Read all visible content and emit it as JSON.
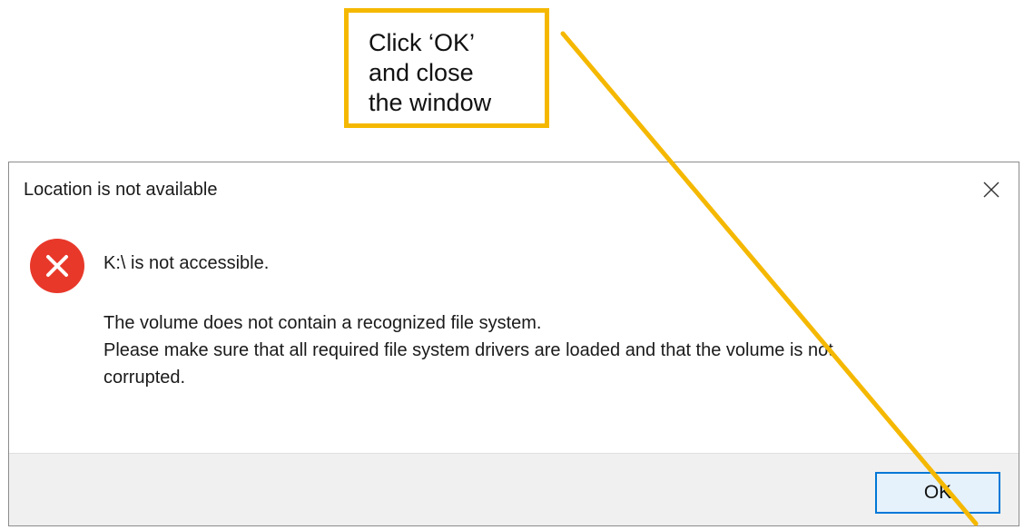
{
  "annotation": {
    "lines": [
      "Click ‘OK’",
      "and close",
      "the window"
    ],
    "color": "#f5b800"
  },
  "dialog": {
    "title": "Location is not available",
    "close_icon": "close-icon",
    "error_icon": "error-circle-x-icon",
    "error_color": "#e8382a",
    "message_main": "K:\\ is not accessible.",
    "message_detail": [
      "The volume does not contain a recognized file system.",
      "Please make sure that all required file system drivers are loaded and that the volume is not",
      "corrupted."
    ],
    "ok_label": "OK",
    "accent_color": "#0078d7"
  }
}
